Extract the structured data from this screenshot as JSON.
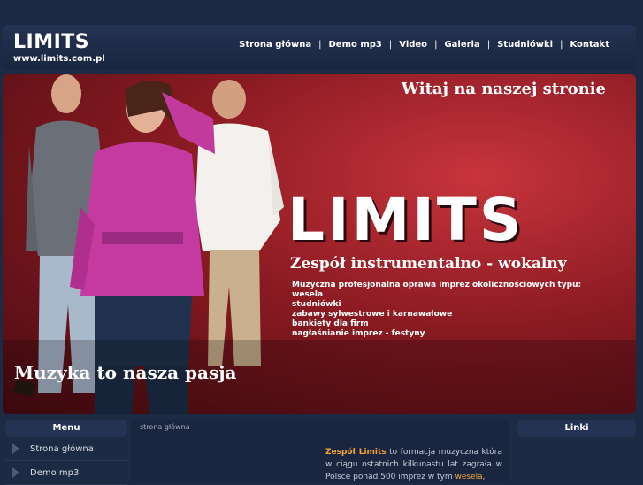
{
  "header": {
    "logo_title": "LIMITS",
    "logo_url": "www.limits.com.pl",
    "nav": [
      "Strona główna",
      "Demo mp3",
      "Video",
      "Galeria",
      "Studniówki",
      "Kontakt"
    ]
  },
  "banner": {
    "welcome": "Witaj na naszej stronie",
    "big_logo": "LIMITS",
    "subtitle": "Zespół instrumentalno - wokalny",
    "services": [
      "Muzyczna profesjonalna oprawa imprez okolicznościowych typu:",
      "wesela",
      "studniówki",
      "zabawy sylwestrowe i karnawałowe",
      "bankiety dla firm",
      "nagłaśnianie imprez - festyny"
    ],
    "slogan": "Muzyka to nasza pasja"
  },
  "left_col": {
    "heading": "Menu",
    "items": [
      "Strona główna",
      "Demo mp3"
    ]
  },
  "content": {
    "breadcrumb": "strona główna",
    "intro_highlight": "Zespół Limits",
    "intro_text": " to formacja muzyczna która w ciągu ostatnich kilkunastu lat zagrała w Polsce ponad 500 imprez w tym ",
    "intro_link": "wesela,"
  },
  "right_col": {
    "heading": "Linki"
  },
  "colors": {
    "page_bg": "#1d2a44",
    "accent": "#f2a33a",
    "banner_red": "#c8343c"
  }
}
